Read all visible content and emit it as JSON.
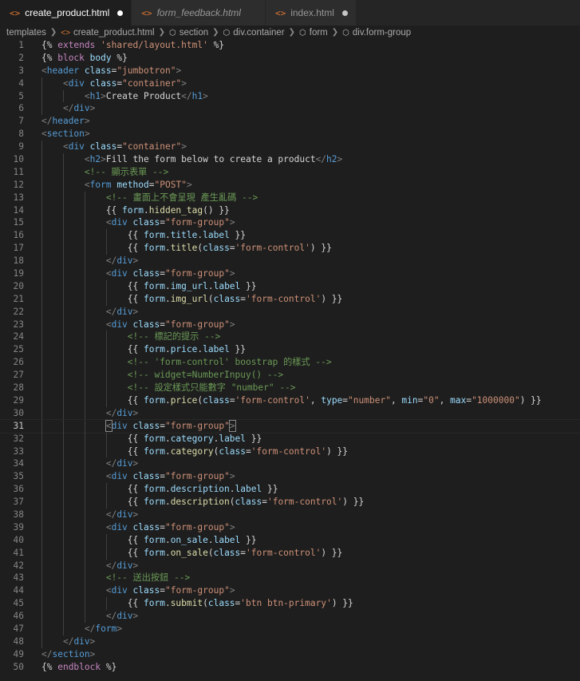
{
  "tabs": [
    {
      "label": "create_product.html",
      "active": true,
      "italic": false,
      "dirty": true
    },
    {
      "label": "form_feedback.html",
      "active": false,
      "italic": true,
      "dirty": false
    },
    {
      "label": "index.html",
      "active": false,
      "italic": false,
      "dirty": true
    }
  ],
  "breadcrumb": [
    {
      "label": "templates",
      "icon": ""
    },
    {
      "label": "create_product.html",
      "icon": "html-file-icon"
    },
    {
      "label": "section",
      "icon": "element-cube-icon"
    },
    {
      "label": "div.container",
      "icon": "element-cube-icon"
    },
    {
      "label": "form",
      "icon": "element-cube-icon"
    },
    {
      "label": "div.form-group",
      "icon": "element-cube-icon"
    }
  ],
  "editor": {
    "current_line": 31,
    "lines": [
      [
        [
          "tx",
          "{% "
        ],
        [
          "kw",
          "extends"
        ],
        [
          "st",
          " 'shared/layout.html'"
        ],
        [
          "tx",
          " %}"
        ]
      ],
      [
        [
          "tx",
          "{% "
        ],
        [
          "kw",
          "block"
        ],
        [
          "vr",
          " body"
        ],
        [
          "tx",
          " %}"
        ]
      ],
      [
        [
          "tg",
          "<"
        ],
        [
          "tn",
          "header"
        ],
        [
          "tx",
          " "
        ],
        [
          "at",
          "class"
        ],
        [
          "tx",
          "="
        ],
        [
          "st",
          "\"jumbotron\""
        ],
        [
          "tg",
          ">"
        ]
      ],
      [
        [
          "tx",
          "    "
        ],
        [
          "tg",
          "<"
        ],
        [
          "tn",
          "div"
        ],
        [
          "tx",
          " "
        ],
        [
          "at",
          "class"
        ],
        [
          "tx",
          "="
        ],
        [
          "st",
          "\"container\""
        ],
        [
          "tg",
          ">"
        ]
      ],
      [
        [
          "tx",
          "        "
        ],
        [
          "tg",
          "<"
        ],
        [
          "tn",
          "h1"
        ],
        [
          "tg",
          ">"
        ],
        [
          "tx",
          "Create Product"
        ],
        [
          "tg",
          "</"
        ],
        [
          "tn",
          "h1"
        ],
        [
          "tg",
          ">"
        ]
      ],
      [
        [
          "tx",
          "    "
        ],
        [
          "tg",
          "</"
        ],
        [
          "tn",
          "div"
        ],
        [
          "tg",
          ">"
        ]
      ],
      [
        [
          "tg",
          "</"
        ],
        [
          "tn",
          "header"
        ],
        [
          "tg",
          ">"
        ]
      ],
      [
        [
          "tg",
          "<"
        ],
        [
          "tn",
          "section"
        ],
        [
          "tg",
          ">"
        ]
      ],
      [
        [
          "tx",
          "    "
        ],
        [
          "tg",
          "<"
        ],
        [
          "tn",
          "div"
        ],
        [
          "tx",
          " "
        ],
        [
          "at",
          "class"
        ],
        [
          "tx",
          "="
        ],
        [
          "st",
          "\"container\""
        ],
        [
          "tg",
          ">"
        ]
      ],
      [
        [
          "tx",
          "        "
        ],
        [
          "tg",
          "<"
        ],
        [
          "tn",
          "h2"
        ],
        [
          "tg",
          ">"
        ],
        [
          "tx",
          "Fill the form below to create a product"
        ],
        [
          "tg",
          "</"
        ],
        [
          "tn",
          "h2"
        ],
        [
          "tg",
          ">"
        ]
      ],
      [
        [
          "tx",
          "        "
        ],
        [
          "cm",
          "<!-- 顯示表單 -->"
        ]
      ],
      [
        [
          "tx",
          "        "
        ],
        [
          "tg",
          "<"
        ],
        [
          "tn",
          "form"
        ],
        [
          "tx",
          " "
        ],
        [
          "at",
          "method"
        ],
        [
          "tx",
          "="
        ],
        [
          "st",
          "\"POST\""
        ],
        [
          "tg",
          ">"
        ]
      ],
      [
        [
          "tx",
          "            "
        ],
        [
          "cm",
          "<!-- 畫面上不會呈現 產生亂碼 -->"
        ]
      ],
      [
        [
          "tx",
          "            {{ "
        ],
        [
          "vr",
          "form"
        ],
        [
          "tx",
          "."
        ],
        [
          "fn",
          "hidden_tag"
        ],
        [
          "tx",
          "() }}"
        ]
      ],
      [
        [
          "tx",
          "            "
        ],
        [
          "tg",
          "<"
        ],
        [
          "tn",
          "div"
        ],
        [
          "tx",
          " "
        ],
        [
          "at",
          "class"
        ],
        [
          "tx",
          "="
        ],
        [
          "st",
          "\"form-group\""
        ],
        [
          "tg",
          ">"
        ]
      ],
      [
        [
          "tx",
          "                {{ "
        ],
        [
          "vr",
          "form"
        ],
        [
          "tx",
          "."
        ],
        [
          "vr",
          "title"
        ],
        [
          "tx",
          "."
        ],
        [
          "vr",
          "label"
        ],
        [
          "tx",
          " }}"
        ]
      ],
      [
        [
          "tx",
          "                {{ "
        ],
        [
          "vr",
          "form"
        ],
        [
          "tx",
          "."
        ],
        [
          "fn",
          "title"
        ],
        [
          "tx",
          "("
        ],
        [
          "vr",
          "class"
        ],
        [
          "tx",
          "="
        ],
        [
          "st",
          "'form-control'"
        ],
        [
          "tx",
          ") }}"
        ]
      ],
      [
        [
          "tx",
          "            "
        ],
        [
          "tg",
          "</"
        ],
        [
          "tn",
          "div"
        ],
        [
          "tg",
          ">"
        ]
      ],
      [
        [
          "tx",
          "            "
        ],
        [
          "tg",
          "<"
        ],
        [
          "tn",
          "div"
        ],
        [
          "tx",
          " "
        ],
        [
          "at",
          "class"
        ],
        [
          "tx",
          "="
        ],
        [
          "st",
          "\"form-group\""
        ],
        [
          "tg",
          ">"
        ]
      ],
      [
        [
          "tx",
          "                {{ "
        ],
        [
          "vr",
          "form"
        ],
        [
          "tx",
          "."
        ],
        [
          "vr",
          "img_url"
        ],
        [
          "tx",
          "."
        ],
        [
          "vr",
          "label"
        ],
        [
          "tx",
          " }}"
        ]
      ],
      [
        [
          "tx",
          "                {{ "
        ],
        [
          "vr",
          "form"
        ],
        [
          "tx",
          "."
        ],
        [
          "fn",
          "img_url"
        ],
        [
          "tx",
          "("
        ],
        [
          "vr",
          "class"
        ],
        [
          "tx",
          "="
        ],
        [
          "st",
          "'form-control'"
        ],
        [
          "tx",
          ") }}"
        ]
      ],
      [
        [
          "tx",
          "            "
        ],
        [
          "tg",
          "</"
        ],
        [
          "tn",
          "div"
        ],
        [
          "tg",
          ">"
        ]
      ],
      [
        [
          "tx",
          "            "
        ],
        [
          "tg",
          "<"
        ],
        [
          "tn",
          "div"
        ],
        [
          "tx",
          " "
        ],
        [
          "at",
          "class"
        ],
        [
          "tx",
          "="
        ],
        [
          "st",
          "\"form-group\""
        ],
        [
          "tg",
          ">"
        ]
      ],
      [
        [
          "tx",
          "                "
        ],
        [
          "cm",
          "<!-- 標記的提示 -->"
        ]
      ],
      [
        [
          "tx",
          "                {{ "
        ],
        [
          "vr",
          "form"
        ],
        [
          "tx",
          "."
        ],
        [
          "vr",
          "price"
        ],
        [
          "tx",
          "."
        ],
        [
          "vr",
          "label"
        ],
        [
          "tx",
          " }}"
        ]
      ],
      [
        [
          "tx",
          "                "
        ],
        [
          "cm",
          "<!-- 'form-control' boostrap 的樣式 -->"
        ]
      ],
      [
        [
          "tx",
          "                "
        ],
        [
          "cm",
          "<!-- widget=NumberInpuy() -->"
        ]
      ],
      [
        [
          "tx",
          "                "
        ],
        [
          "cm",
          "<!-- 設定樣式只能數字 \"number\" -->"
        ]
      ],
      [
        [
          "tx",
          "                {{ "
        ],
        [
          "vr",
          "form"
        ],
        [
          "tx",
          "."
        ],
        [
          "fn",
          "price"
        ],
        [
          "tx",
          "("
        ],
        [
          "vr",
          "class"
        ],
        [
          "tx",
          "="
        ],
        [
          "st",
          "'form-control'"
        ],
        [
          "tx",
          ", "
        ],
        [
          "vr",
          "type"
        ],
        [
          "tx",
          "="
        ],
        [
          "st",
          "\"number\""
        ],
        [
          "tx",
          ", "
        ],
        [
          "vr",
          "min"
        ],
        [
          "tx",
          "="
        ],
        [
          "st",
          "\"0\""
        ],
        [
          "tx",
          ", "
        ],
        [
          "vr",
          "max"
        ],
        [
          "tx",
          "="
        ],
        [
          "st",
          "\"1000000\""
        ],
        [
          "tx",
          ") }}"
        ]
      ],
      [
        [
          "tx",
          "            "
        ],
        [
          "tg",
          "</"
        ],
        [
          "tn",
          "div"
        ],
        [
          "tg",
          ">"
        ]
      ],
      [
        [
          "tx",
          "            "
        ],
        [
          "tgm",
          "<"
        ],
        [
          "tn",
          "div"
        ],
        [
          "tx",
          " "
        ],
        [
          "at",
          "class"
        ],
        [
          "tx",
          "="
        ],
        [
          "st",
          "\"form-group\""
        ],
        [
          "tgm",
          ">"
        ]
      ],
      [
        [
          "tx",
          "                {{ "
        ],
        [
          "vr",
          "form"
        ],
        [
          "tx",
          "."
        ],
        [
          "vr",
          "category"
        ],
        [
          "tx",
          "."
        ],
        [
          "vr",
          "label"
        ],
        [
          "tx",
          " }}"
        ]
      ],
      [
        [
          "tx",
          "                {{ "
        ],
        [
          "vr",
          "form"
        ],
        [
          "tx",
          "."
        ],
        [
          "fn",
          "category"
        ],
        [
          "tx",
          "("
        ],
        [
          "vr",
          "class"
        ],
        [
          "tx",
          "="
        ],
        [
          "st",
          "'form-control'"
        ],
        [
          "tx",
          ") }}"
        ]
      ],
      [
        [
          "tx",
          "            "
        ],
        [
          "tg",
          "</"
        ],
        [
          "tn",
          "div"
        ],
        [
          "tg",
          ">"
        ]
      ],
      [
        [
          "tx",
          "            "
        ],
        [
          "tg",
          "<"
        ],
        [
          "tn",
          "div"
        ],
        [
          "tx",
          " "
        ],
        [
          "at",
          "class"
        ],
        [
          "tx",
          "="
        ],
        [
          "st",
          "\"form-group\""
        ],
        [
          "tg",
          ">"
        ]
      ],
      [
        [
          "tx",
          "                {{ "
        ],
        [
          "vr",
          "form"
        ],
        [
          "tx",
          "."
        ],
        [
          "vr",
          "description"
        ],
        [
          "tx",
          "."
        ],
        [
          "vr",
          "label"
        ],
        [
          "tx",
          " }}"
        ]
      ],
      [
        [
          "tx",
          "                {{ "
        ],
        [
          "vr",
          "form"
        ],
        [
          "tx",
          "."
        ],
        [
          "fn",
          "description"
        ],
        [
          "tx",
          "("
        ],
        [
          "vr",
          "class"
        ],
        [
          "tx",
          "="
        ],
        [
          "st",
          "'form-control'"
        ],
        [
          "tx",
          ") }}"
        ]
      ],
      [
        [
          "tx",
          "            "
        ],
        [
          "tg",
          "</"
        ],
        [
          "tn",
          "div"
        ],
        [
          "tg",
          ">"
        ]
      ],
      [
        [
          "tx",
          "            "
        ],
        [
          "tg",
          "<"
        ],
        [
          "tn",
          "div"
        ],
        [
          "tx",
          " "
        ],
        [
          "at",
          "class"
        ],
        [
          "tx",
          "="
        ],
        [
          "st",
          "\"form-group\""
        ],
        [
          "tg",
          ">"
        ]
      ],
      [
        [
          "tx",
          "                {{ "
        ],
        [
          "vr",
          "form"
        ],
        [
          "tx",
          "."
        ],
        [
          "vr",
          "on_sale"
        ],
        [
          "tx",
          "."
        ],
        [
          "vr",
          "label"
        ],
        [
          "tx",
          " }}"
        ]
      ],
      [
        [
          "tx",
          "                {{ "
        ],
        [
          "vr",
          "form"
        ],
        [
          "tx",
          "."
        ],
        [
          "fn",
          "on_sale"
        ],
        [
          "tx",
          "("
        ],
        [
          "vr",
          "class"
        ],
        [
          "tx",
          "="
        ],
        [
          "st",
          "'form-control'"
        ],
        [
          "tx",
          ") }}"
        ]
      ],
      [
        [
          "tx",
          "            "
        ],
        [
          "tg",
          "</"
        ],
        [
          "tn",
          "div"
        ],
        [
          "tg",
          ">"
        ]
      ],
      [
        [
          "tx",
          "            "
        ],
        [
          "cm",
          "<!-- 送出按鈕 -->"
        ]
      ],
      [
        [
          "tx",
          "            "
        ],
        [
          "tg",
          "<"
        ],
        [
          "tn",
          "div"
        ],
        [
          "tx",
          " "
        ],
        [
          "at",
          "class"
        ],
        [
          "tx",
          "="
        ],
        [
          "st",
          "\"form-group\""
        ],
        [
          "tg",
          ">"
        ]
      ],
      [
        [
          "tx",
          "                {{ "
        ],
        [
          "vr",
          "form"
        ],
        [
          "tx",
          "."
        ],
        [
          "fn",
          "submit"
        ],
        [
          "tx",
          "("
        ],
        [
          "vr",
          "class"
        ],
        [
          "tx",
          "="
        ],
        [
          "st",
          "'btn btn-primary'"
        ],
        [
          "tx",
          ") }}"
        ]
      ],
      [
        [
          "tx",
          "            "
        ],
        [
          "tg",
          "</"
        ],
        [
          "tn",
          "div"
        ],
        [
          "tg",
          ">"
        ]
      ],
      [
        [
          "tx",
          "        "
        ],
        [
          "tg",
          "</"
        ],
        [
          "tn",
          "form"
        ],
        [
          "tg",
          ">"
        ]
      ],
      [
        [
          "tx",
          "    "
        ],
        [
          "tg",
          "</"
        ],
        [
          "tn",
          "div"
        ],
        [
          "tg",
          ">"
        ]
      ],
      [
        [
          "tg",
          "</"
        ],
        [
          "tn",
          "section"
        ],
        [
          "tg",
          ">"
        ]
      ],
      [
        [
          "tx",
          "{% "
        ],
        [
          "kw",
          "endblock"
        ],
        [
          "tx",
          " %}"
        ]
      ]
    ]
  }
}
